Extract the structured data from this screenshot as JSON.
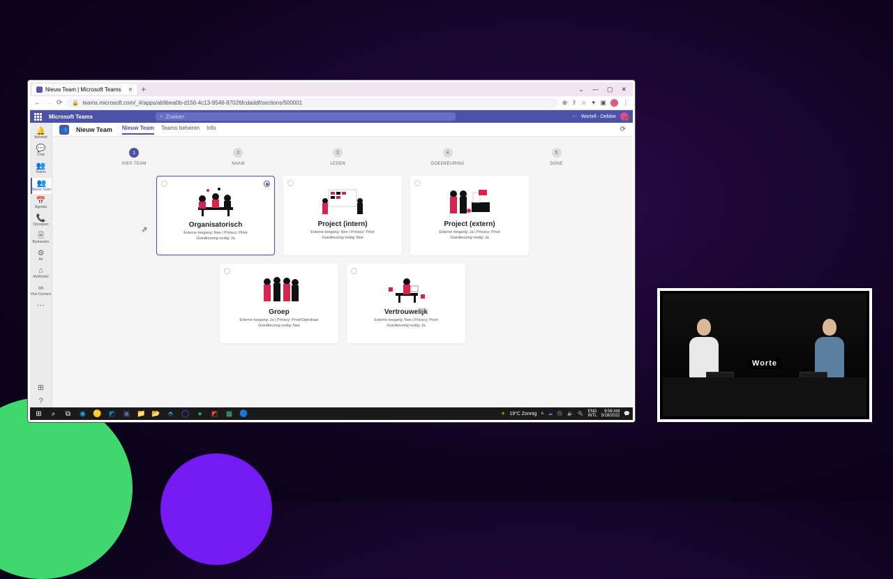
{
  "browser": {
    "tab_title": "Nieuw Team | Microsoft Teams",
    "url": "teams.microsoft.com/_#/apps/ab9bea0b-d156-4c13-9546-87026fcdaddf/sections/500001"
  },
  "teams_header": {
    "app_name": "Microsoft Teams",
    "search_placeholder": "Zoeken",
    "user_label": "Wortell - Debbie"
  },
  "rail": [
    {
      "label": "Activiteit"
    },
    {
      "label": "Chat"
    },
    {
      "label": "Teams"
    },
    {
      "label": "Nieuw Team",
      "active": true
    },
    {
      "label": "Agenda"
    },
    {
      "label": "Oproepen"
    },
    {
      "label": "Bestanden"
    },
    {
      "label": "Ae"
    },
    {
      "label": "MyWortell"
    },
    {
      "label": "Viva Connect"
    }
  ],
  "page": {
    "title": "Nieuw Team",
    "tabs": [
      "Nieuw Team",
      "Teams beheren",
      "Info"
    ],
    "active_tab": 0
  },
  "stepper": [
    {
      "num": "1",
      "label": "KIES TEAM",
      "active": true
    },
    {
      "num": "2",
      "label": "NAAM"
    },
    {
      "num": "3",
      "label": "LEDEN"
    },
    {
      "num": "4",
      "label": "GOEDKEURING"
    },
    {
      "num": "5",
      "label": "DONE"
    }
  ],
  "cards": [
    {
      "title": "Organisatorisch",
      "line1": "Externe toegang: Nee | Privacy: Privé",
      "line2": "Goedkeuring nodig: Ja",
      "selected": true
    },
    {
      "title": "Project (intern)",
      "line1": "Externe toegang: Nee | Privacy: Privé",
      "line2": "Goedkeuring nodig: Nee"
    },
    {
      "title": "Project (extern)",
      "line1": "Externe toegang: Ja | Privacy: Privé",
      "line2": "Goedkeuring nodig: Ja"
    },
    {
      "title": "Groep",
      "line1": "Externe toegang: Ja | Privacy: Privé/Openbaar",
      "line2": "Goedkeuring nodig: Nee"
    },
    {
      "title": "Vertrouwelijk",
      "line1": "Externe toegang: Nee | Privacy: Privé",
      "line2": "Goedkeuring nodig: Ja"
    }
  ],
  "taskbar": {
    "weather": "19°C  Zonnig",
    "lang1": "ENG",
    "lang2": "INTL",
    "time": "9:56 AM",
    "date": "5/18/2022"
  },
  "webcam_sign": "Worte"
}
